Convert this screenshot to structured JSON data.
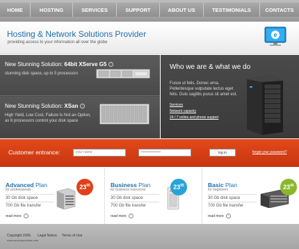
{
  "nav": {
    "items": [
      "HOME",
      "HOSTING",
      "SERVICES",
      "SUPPORT",
      "ABOUT US",
      "TESTIMONIALS",
      "CONTACTS"
    ]
  },
  "header": {
    "title": "Hosting & Network Solutions Provider",
    "slogan": "providing access to your information all over the globe"
  },
  "promos": [
    {
      "title_prefix": "New Stunning Solution: ",
      "title_bold": "64bit XServe G5",
      "text": "stunning disk space, up to 5 processors"
    },
    {
      "title_prefix": "New Stunning Solution: ",
      "title_bold": "XSan",
      "text": "High Yield, Low Cost, Failure Is Not an Option, as 6 processors control your disk space"
    }
  ],
  "about": {
    "title": "Who we are & what we do",
    "text": "Fusce ut felis. Donec urna. Pellentesque vulputate lectus eget felis. Duis sagittis purus sit amet est.",
    "links": [
      "Services",
      "Network capacity",
      "24 / 7 online and phone support"
    ]
  },
  "login": {
    "label": "Customer entrance:",
    "username_value": "your name",
    "password_value": "••••••••••••••••",
    "button": "log in",
    "forgot": "forgot your password?"
  },
  "plans": [
    {
      "name": "Advanced",
      "word": " Plan",
      "sub": "for professionals",
      "disk": "30 Gb disk space",
      "transfer": "700 Gb file transfer",
      "more": "read more",
      "price": "23",
      "cents": "95",
      "color": "#e0401a"
    },
    {
      "name": "Business",
      "word": " Plan",
      "sub": "for business resources",
      "disk": "30 Gb disk space",
      "transfer": "700 Gb file transfer",
      "more": "read more",
      "price": "23",
      "cents": "95",
      "color": "#27a3d8"
    },
    {
      "name": "Basic",
      "word": " Plan",
      "sub": "for beginners",
      "disk": "30 Gb disk space",
      "transfer": "700 Gb file transfer",
      "more": "read more",
      "price": "23",
      "cents": "95",
      "color": "#8ab82a"
    }
  ],
  "footer": {
    "copyright": "Copyright 2006.",
    "legal": "Legal Notice.",
    "terms": "Terms of Use",
    "domain": "www.serviceprovider.com"
  },
  "colors": {
    "accent": "#1d6fb0",
    "login_bar": "#d23c14"
  }
}
